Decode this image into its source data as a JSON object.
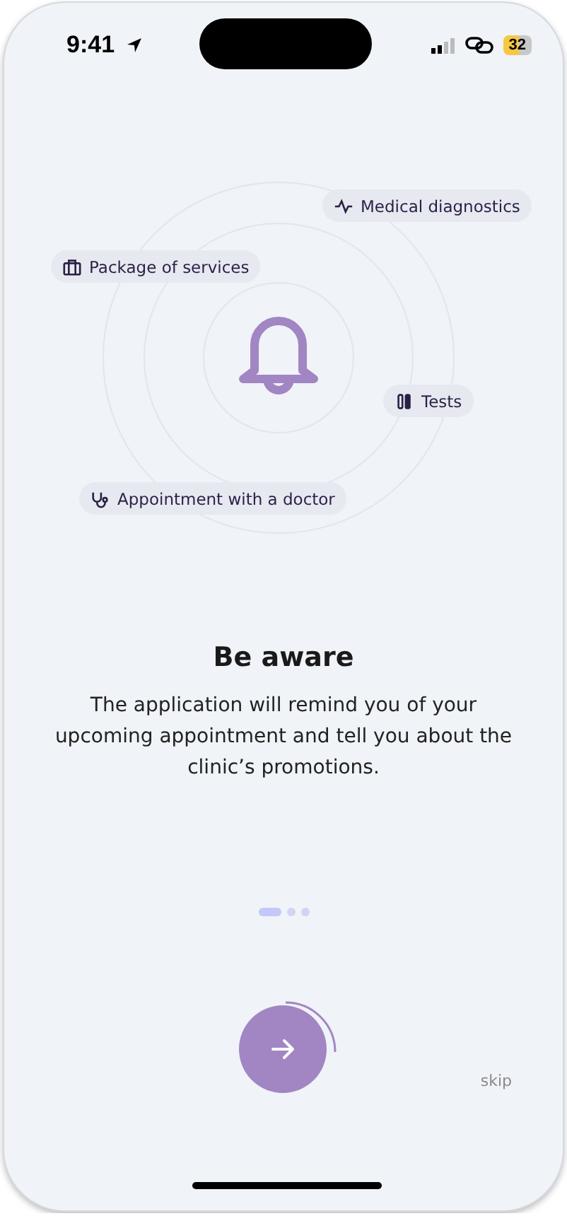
{
  "status_bar": {
    "time": "9:41",
    "battery": "32"
  },
  "tags": [
    {
      "label": "Medical diagnostics",
      "kind": "pulse"
    },
    {
      "label": "Package of services",
      "kind": "case"
    },
    {
      "label": "Tests",
      "kind": "tubes"
    },
    {
      "label": "Appointment with a doctor",
      "kind": "stethoscope"
    }
  ],
  "title": "Be aware",
  "description": "The application will remind you of your upcoming appointment and tell you about the clinic’s promotions.",
  "pages": [
    {
      "selected": true
    },
    {
      "selected": false
    },
    {
      "selected": false
    }
  ],
  "skip": "skip"
}
